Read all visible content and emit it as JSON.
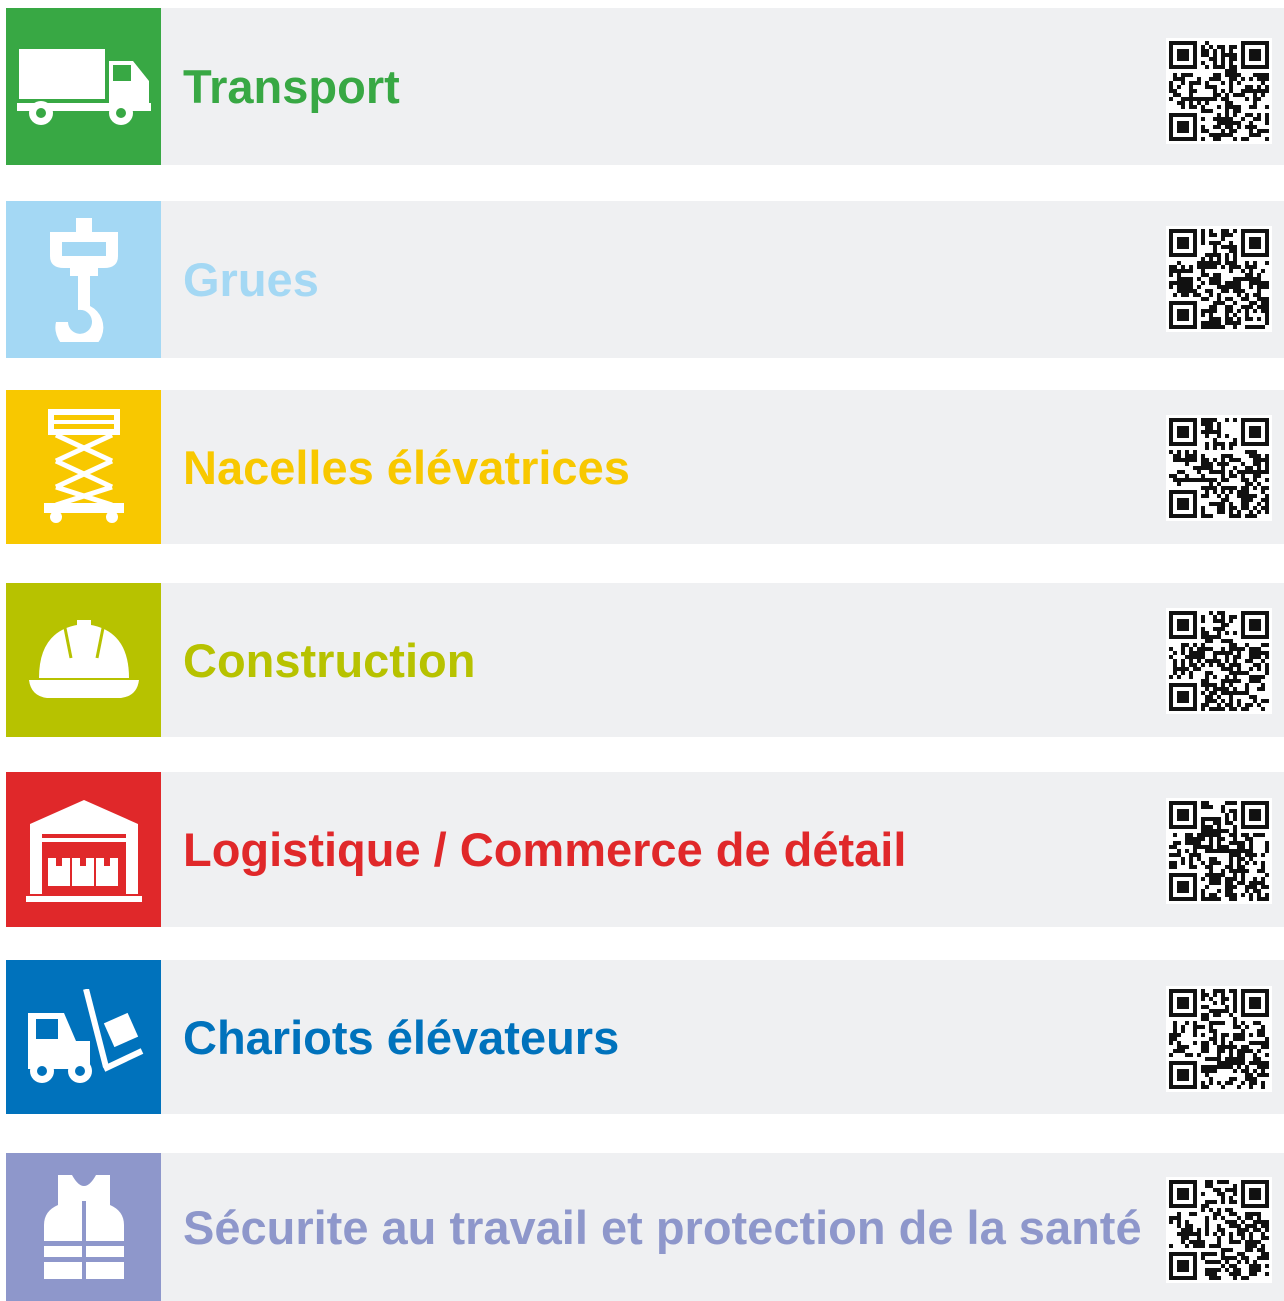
{
  "rows": [
    {
      "label": "Transport",
      "color": "#38a844",
      "icon": "truck-icon"
    },
    {
      "label": "Grues",
      "color": "#a4d8f4",
      "icon": "crane-hook-icon"
    },
    {
      "label": "Nacelles élévatrices",
      "color": "#f8c800",
      "icon": "scissor-lift-icon"
    },
    {
      "label": "Construction",
      "color": "#b7c200",
      "icon": "hard-hat-icon"
    },
    {
      "label": "Logistique / Commerce de détail",
      "color": "#e0282a",
      "icon": "warehouse-icon"
    },
    {
      "label": "Chariots élévateurs",
      "color": "#0072bc",
      "icon": "forklift-icon"
    },
    {
      "label": "Sécurite au travail et protection de la santé",
      "color": "#8e97cb",
      "icon": "safety-vest-icon"
    }
  ]
}
